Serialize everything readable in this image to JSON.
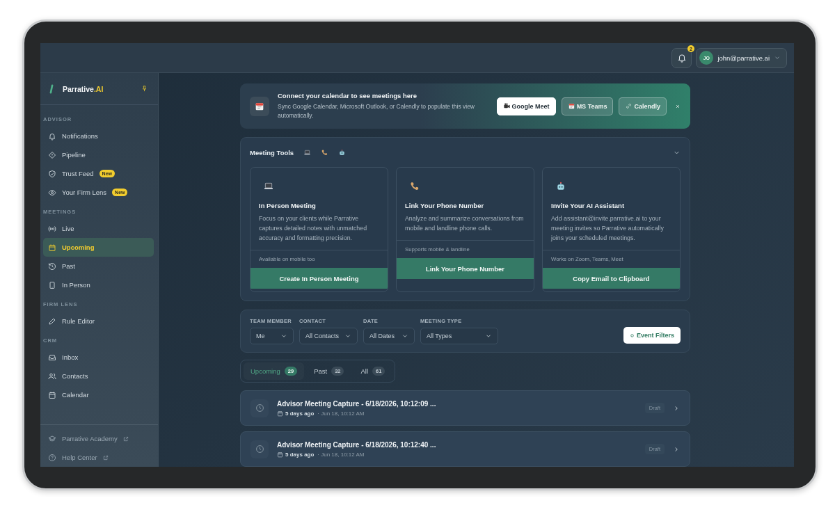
{
  "topbar": {
    "notifications": {
      "count": "2"
    },
    "user": {
      "initials": "JO",
      "email": "john@parrative.ai"
    }
  },
  "sidebar": {
    "brand": {
      "name": "Parrative",
      "suffix": ".AI"
    },
    "sections": [
      {
        "title": "ADVISOR",
        "items": [
          {
            "label": "Notifications",
            "selected": false
          },
          {
            "label": "Pipeline",
            "selected": false
          },
          {
            "label": "Trust Feed",
            "selected": false,
            "badge": "New"
          },
          {
            "label": "Your Firm Lens",
            "selected": false,
            "badge": "New"
          }
        ]
      },
      {
        "title": "MEETINGS",
        "items": [
          {
            "label": "Live",
            "selected": false
          },
          {
            "label": "Upcoming",
            "selected": true
          },
          {
            "label": "Past",
            "selected": false
          },
          {
            "label": "In Person",
            "selected": false
          }
        ]
      },
      {
        "title": "FIRM LENS",
        "items": [
          {
            "label": "Rule Editor",
            "selected": false
          }
        ]
      },
      {
        "title": "CRM",
        "items": [
          {
            "label": "Inbox",
            "selected": false
          },
          {
            "label": "Contacts",
            "selected": false
          },
          {
            "label": "Calendar",
            "selected": false
          }
        ]
      }
    ],
    "footer": [
      {
        "label": "Parrative Academy",
        "external": true
      },
      {
        "label": "Help Center",
        "external": true
      }
    ]
  },
  "banner": {
    "title": "Connect your calendar to see meetings here",
    "text": "Sync Google Calendar, Microsoft Outlook, or Calendly to populate this view automatically.",
    "buttons": [
      {
        "label": "Google Meet",
        "kind": "primary"
      },
      {
        "label": "MS Teams",
        "kind": "secondary"
      },
      {
        "label": "Calendly",
        "kind": "secondary"
      }
    ]
  },
  "meeting_tools": {
    "title": "Meeting Tools",
    "expanded": true,
    "cards": [
      {
        "title": "In Person Meeting",
        "text": "Focus on your clients while Parrative captures detailed notes with unmatched accuracy and formatting precision.",
        "note": "Available on mobile too",
        "button": "Create In Person Meeting"
      },
      {
        "title": "Link Your Phone Number",
        "text": "Analyze and summarize conversations from mobile and landline phone calls.",
        "note": "Supports mobile & landline",
        "button": "Link Your Phone Number"
      },
      {
        "title": "Invite Your AI Assistant",
        "text": "Add assistant@invite.parrative.ai to your meeting invites so Parrative automatically joins your scheduled meetings.",
        "note": "Works on Zoom, Teams, Meet",
        "button": "Copy Email to Clipboard"
      }
    ]
  },
  "filters": {
    "fields": [
      {
        "label": "TEAM MEMBER",
        "value": "Me"
      },
      {
        "label": "CONTACT",
        "value": "All Contacts"
      },
      {
        "label": "DATE",
        "value": "All Dates"
      },
      {
        "label": "MEETING TYPE",
        "value": "All Types"
      }
    ],
    "button": "Event Filters"
  },
  "tabs": [
    {
      "label": "Upcoming",
      "count": "29",
      "selected": true
    },
    {
      "label": "Past",
      "count": "32",
      "selected": false
    },
    {
      "label": "All",
      "count": "61",
      "selected": false
    }
  ],
  "meetings": [
    {
      "title": "Advisor Meeting Capture - 6/18/2026, 10:12:09 ...",
      "relative": "5 days ago",
      "date": "· Jun 18, 10:12 AM",
      "status": "Draft"
    },
    {
      "title": "Advisor Meeting Capture - 6/18/2026, 10:12:40 ...",
      "relative": "5 days ago",
      "date": "· Jun 18, 10:12 AM",
      "status": "Draft"
    }
  ]
}
